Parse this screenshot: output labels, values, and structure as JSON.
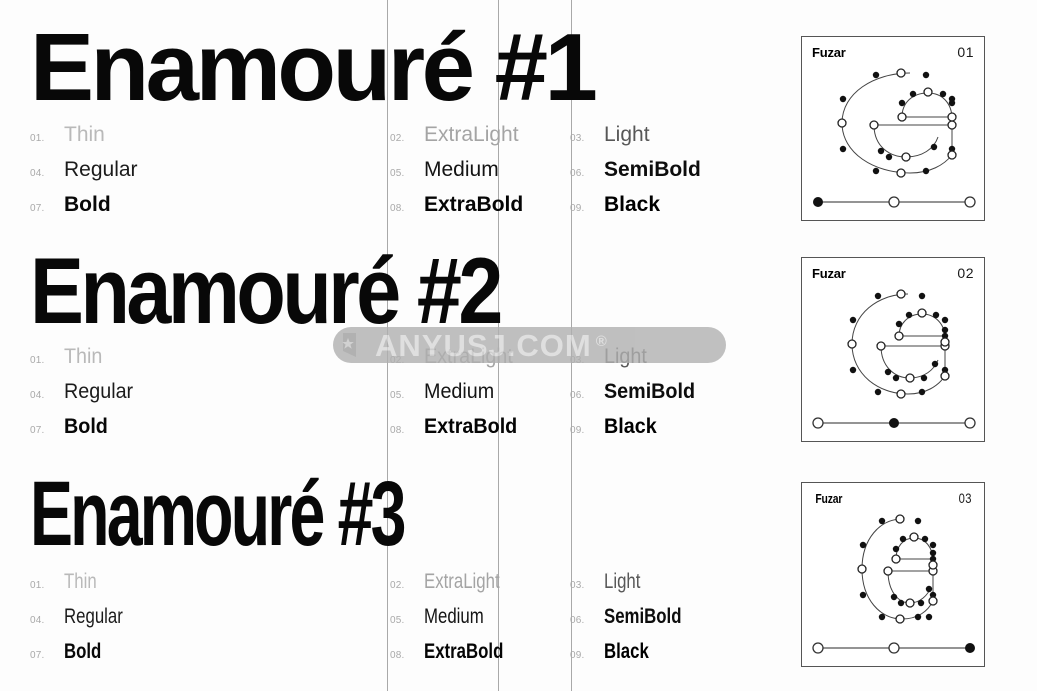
{
  "page": {
    "background_color": "#fdfdfd",
    "guide_line_color": "#9a9a9a",
    "guide_positions": [
      387,
      498,
      571
    ]
  },
  "watermark": {
    "text": "ANYUSJ.COM",
    "registered_mark": "®",
    "logo_icon": "shield-star-icon",
    "background_color": "#b0b0b0",
    "text_color": "#d8d8d8"
  },
  "specimens": [
    {
      "headline": "Enamouré #1",
      "width_style": "wide",
      "weights": [
        {
          "num": "01.",
          "name": "Thin"
        },
        {
          "num": "02.",
          "name": "ExtraLight"
        },
        {
          "num": "03.",
          "name": "Light"
        },
        {
          "num": "04.",
          "name": "Regular"
        },
        {
          "num": "05.",
          "name": "Medium"
        },
        {
          "num": "06.",
          "name": "SemiBold"
        },
        {
          "num": "07.",
          "name": "Bold"
        },
        {
          "num": "08.",
          "name": "ExtraBold"
        },
        {
          "num": "09.",
          "name": "Black"
        }
      ]
    },
    {
      "headline": "Enamouré #2",
      "width_style": "normal",
      "weights": [
        {
          "num": "01.",
          "name": "Thin"
        },
        {
          "num": "02.",
          "name": "ExtraLight"
        },
        {
          "num": "03.",
          "name": "Light"
        },
        {
          "num": "04.",
          "name": "Regular"
        },
        {
          "num": "05.",
          "name": "Medium"
        },
        {
          "num": "06.",
          "name": "SemiBold"
        },
        {
          "num": "07.",
          "name": "Bold"
        },
        {
          "num": "08.",
          "name": "ExtraBold"
        },
        {
          "num": "09.",
          "name": "Black"
        }
      ]
    },
    {
      "headline": "Enamouré #3",
      "width_style": "condensed",
      "weights": [
        {
          "num": "01.",
          "name": "Thin"
        },
        {
          "num": "02.",
          "name": "ExtraLight"
        },
        {
          "num": "03.",
          "name": "Light"
        },
        {
          "num": "04.",
          "name": "Regular"
        },
        {
          "num": "05.",
          "name": "Medium"
        },
        {
          "num": "06.",
          "name": "SemiBold"
        },
        {
          "num": "07.",
          "name": "Bold"
        },
        {
          "num": "08.",
          "name": "ExtraBold"
        },
        {
          "num": "09.",
          "name": "Black"
        }
      ]
    }
  ],
  "cards": [
    {
      "title": "Fuzar",
      "number": "01",
      "glyph": "e",
      "glyph_width": "wide",
      "slider": {
        "stops": 3,
        "active_index": 0
      }
    },
    {
      "title": "Fuzar",
      "number": "02",
      "glyph": "e",
      "glyph_width": "normal",
      "slider": {
        "stops": 3,
        "active_index": 1
      }
    },
    {
      "title": "Fuzar",
      "number": "03",
      "glyph": "e",
      "glyph_width": "condensed",
      "slider": {
        "stops": 3,
        "active_index": 2
      }
    }
  ]
}
